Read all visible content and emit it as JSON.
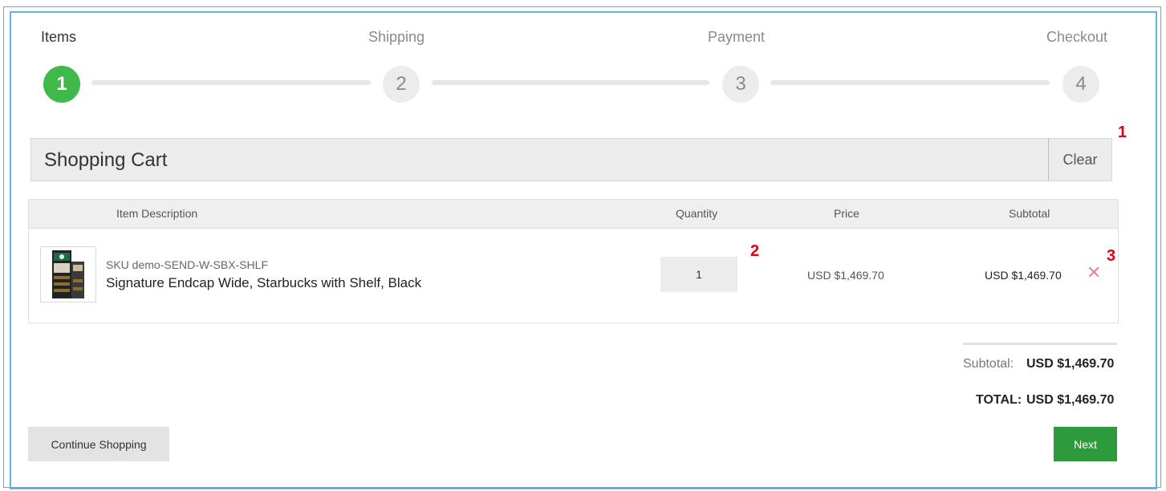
{
  "steps": [
    {
      "label": "Items",
      "number": "1",
      "active": true
    },
    {
      "label": "Shipping",
      "number": "2",
      "active": false
    },
    {
      "label": "Payment",
      "number": "3",
      "active": false
    },
    {
      "label": "Checkout",
      "number": "4",
      "active": false
    }
  ],
  "annotations": {
    "one": "1",
    "two": "2",
    "three": "3"
  },
  "cart": {
    "title": "Shopping Cart",
    "clear_label": "Clear"
  },
  "table": {
    "headers": {
      "description": "Item Description",
      "quantity": "Quantity",
      "price": "Price",
      "subtotal": "Subtotal"
    },
    "items": [
      {
        "sku": "SKU demo-SEND-W-SBX-SHLF",
        "name": "Signature Endcap Wide, Starbucks with Shelf, Black",
        "quantity": "1",
        "price": "USD $1,469.70",
        "subtotal": "USD $1,469.70",
        "remove_icon": "close-icon"
      }
    ]
  },
  "summary": {
    "subtotal_label": "Subtotal:",
    "subtotal_value": "USD $1,469.70",
    "total_label": "TOTAL:",
    "total_value": "USD $1,469.70"
  },
  "actions": {
    "continue_label": "Continue Shopping",
    "next_label": "Next"
  },
  "colors": {
    "active_step": "#3fb94a",
    "next_button": "#2d9a3b",
    "frame_accent": "#5ab8dd",
    "annotation": "#e0001a"
  }
}
